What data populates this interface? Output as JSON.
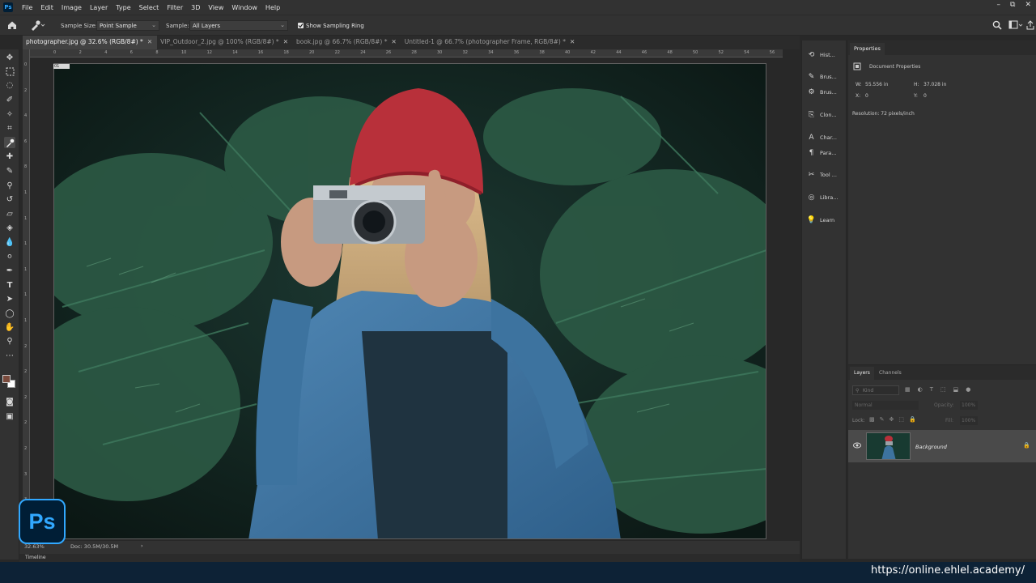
{
  "app": {
    "logo_text": "Ps"
  },
  "menu": [
    "File",
    "Edit",
    "Image",
    "Layer",
    "Type",
    "Select",
    "Filter",
    "3D",
    "View",
    "Window",
    "Help"
  ],
  "window_controls": {
    "minimize": "–",
    "restore": "⧉",
    "close": "✕"
  },
  "options_bar": {
    "sample_size_label": "Sample Size:",
    "sample_size_value": "Point Sample",
    "sample_label": "Sample:",
    "sample_value": "All Layers",
    "show_ring_label": "Show Sampling Ring",
    "show_ring_checked": true
  },
  "tabs": [
    {
      "label": "photographer.jpg @ 32.6% (RGB/8#) *",
      "active": true
    },
    {
      "label": "VIP_Outdoor_2.jpg @ 100% (RGB/8#) *",
      "active": false
    },
    {
      "label": "book.jpg @ 66.7% (RGB/8#) *",
      "active": false
    },
    {
      "label": "Untitled-1 @ 66.7% (photographer Frame, RGB/8#) *",
      "active": false
    }
  ],
  "ruler_h": [
    "0",
    "2",
    "4",
    "6",
    "8",
    "10",
    "12",
    "14",
    "16",
    "18",
    "20",
    "22",
    "24",
    "26",
    "28",
    "30",
    "32",
    "34",
    "36",
    "38",
    "40",
    "42",
    "44",
    "46",
    "48",
    "50",
    "52",
    "54",
    "56"
  ],
  "ruler_v": [
    "0",
    "2",
    "4",
    "6",
    "8",
    "1",
    "1",
    "1",
    "1",
    "1",
    "1",
    "2",
    "2",
    "2",
    "2",
    "2",
    "3",
    "3",
    "3"
  ],
  "frame_badge": "01",
  "status": {
    "zoom": "32.63%",
    "doc": "Doc: 30.5M/30.5M"
  },
  "timeline_label": "Timeline",
  "mid_panels": [
    {
      "icon": "history-icon",
      "glyph": "⟲",
      "label": "Hist..."
    },
    {
      "icon": "brush-icon",
      "glyph": "✎",
      "label": "Brus..."
    },
    {
      "icon": "brush-settings-icon",
      "glyph": "⚙",
      "label": "Brus..."
    },
    {
      "icon": "clone-source-icon",
      "glyph": "⎘",
      "label": "Clon..."
    },
    {
      "icon": "character-icon",
      "glyph": "A",
      "label": "Char..."
    },
    {
      "icon": "paragraph-icon",
      "glyph": "¶",
      "label": "Para..."
    },
    {
      "icon": "tool-presets-icon",
      "glyph": "✂",
      "label": "Tool ..."
    },
    {
      "icon": "libraries-icon",
      "glyph": "◎",
      "label": "Libra..."
    },
    {
      "icon": "learn-icon",
      "glyph": "💡",
      "label": "Learn"
    }
  ],
  "properties": {
    "tab": "Properties",
    "section": "Document Properties",
    "w_label": "W:",
    "w_value": "55.556 in",
    "h_label": "H:",
    "h_value": "37.028 in",
    "x_label": "X:",
    "x_value": "0",
    "y_label": "Y:",
    "y_value": "0",
    "resolution": "Resolution: 72 pixels/inch"
  },
  "layers_panel": {
    "tabs": [
      "Layers",
      "Channels"
    ],
    "kind_placeholder": "Kind",
    "blend_mode": "Normal",
    "opacity_label": "Opacity:",
    "opacity_value": "100%",
    "lock_label": "Lock:",
    "fill_label": "Fill:",
    "fill_value": "100%",
    "layers": [
      {
        "name": "Background",
        "visible": true,
        "locked": true
      }
    ]
  },
  "watermark": "https://online.ehlel.academy/",
  "colors": {
    "foreground": "#7a4a3c",
    "background": "#ffffff",
    "accent": "#31a8ff",
    "footer": "#0d2236"
  }
}
